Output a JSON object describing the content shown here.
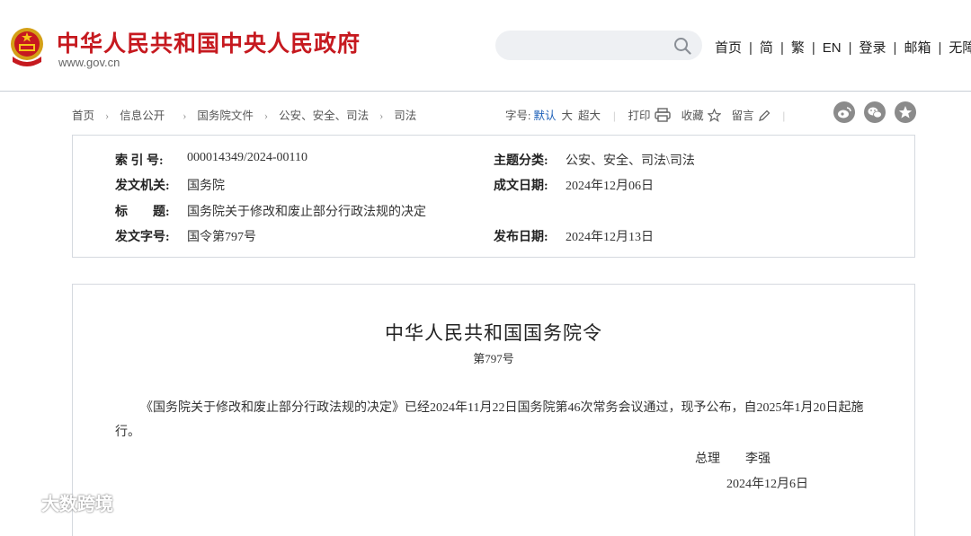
{
  "header": {
    "site_title": "中华人民共和国中央人民政府",
    "site_domain": "www.gov.cn",
    "emblem_icon": "national-emblem-icon",
    "brand_color": "#c6191f",
    "search": {
      "placeholder": "",
      "icon": "search-icon"
    },
    "nav": [
      "首页",
      "简",
      "繁",
      "EN",
      "登录",
      "邮箱",
      "无障碍"
    ]
  },
  "breadcrumb": [
    "首页",
    "信息公开",
    "国务院文件",
    "公安、安全、司法",
    "司法"
  ],
  "tools": {
    "font_size_label": "字号:",
    "font_sizes": [
      "默认",
      "大",
      "超大"
    ],
    "print": "打印",
    "favorite": "收藏",
    "comment": "留言",
    "active_color": "#1b5fb8"
  },
  "share_icons": [
    "weibo-icon",
    "wechat-icon",
    "star-share-icon"
  ],
  "info": {
    "index_label": "索 引 号:",
    "index_value": "000014349/2024-00110",
    "category_label": "主题分类:",
    "category_value": "公安、安全、司法\\司法",
    "issuer_label": "发文机关:",
    "issuer_value": "国务院",
    "written_date_label": "成文日期:",
    "written_date_value": "2024年12月06日",
    "title_label": "标　　题:",
    "title_value": "国务院关于修改和废止部分行政法规的决定",
    "doc_no_label": "发文字号:",
    "doc_no_value": "国令第797号",
    "publish_date_label": "发布日期:",
    "publish_date_value": "2024年12月13日"
  },
  "document": {
    "title": "中华人民共和国国务院令",
    "number": "第797号",
    "paragraph": "《国务院关于修改和废止部分行政法规的决定》已经2024年11月22日国务院第46次常务会议通过，现予公布，自2025年1月20日起施行。",
    "sign_role": "总理",
    "sign_name": "李强",
    "sign_date": "2024年12月6日"
  },
  "watermark": "大数跨境"
}
